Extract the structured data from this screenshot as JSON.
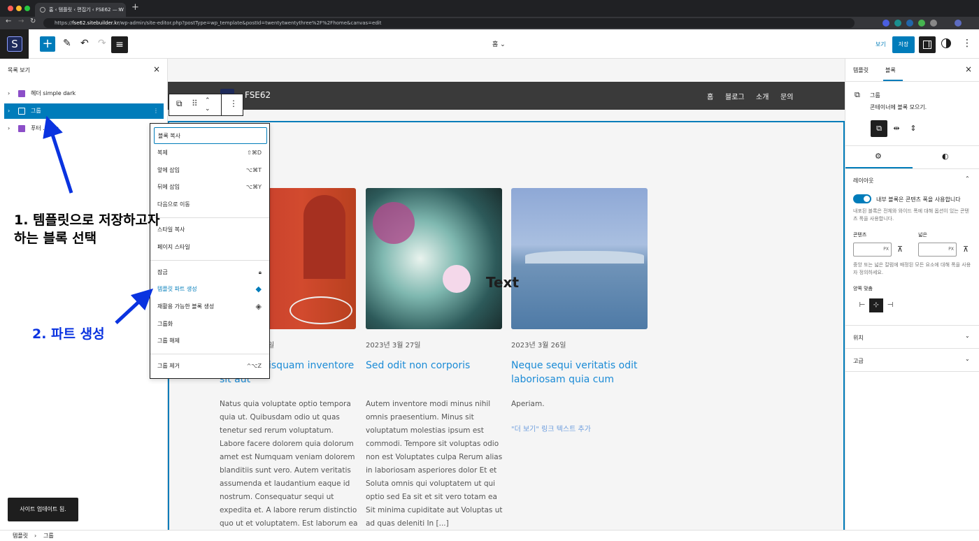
{
  "browser": {
    "tab_title": "홈 ‹ 템플릿 ‹ 편집기 ‹ FSE62 — W",
    "url_host": "fse62.sitebuilder.kr",
    "url_path": "/wp-admin/site-editor.php?postType=wp_template&postId=twentytwentythree%2F%2Fhome&canvas=edit",
    "url_scheme": "https://"
  },
  "header": {
    "document_title": "홈",
    "view_label": "보기",
    "save_label": "저장"
  },
  "list_view": {
    "title": "목록 보기",
    "items": [
      {
        "label": "헤더 simple dark",
        "selected": false
      },
      {
        "label": "그룹",
        "selected": true
      },
      {
        "label": "푸터 ... ofo",
        "selected": false
      }
    ]
  },
  "annotations": {
    "step1": "1. 템플릿으로 저장하고자\n하는 블록 선택",
    "step2": "2. 파트 생성"
  },
  "toast": "사이트 업데이트 됨.",
  "canvas": {
    "site_title": "FSE62",
    "nav": [
      "홈",
      "블로그",
      "소개",
      "문의"
    ],
    "overlay_text": "Text",
    "posts": [
      {
        "date": "일",
        "title": "...tibus quisquam inventore sit aut",
        "excerpt": "Natus quia voluptate optio tempora quia ut. Quibusdam odio ut quas tenetur sed rerum voluptatum. Labore facere dolorem quia dolorum amet est Numquam veniam dolorem blanditiis sunt vero. Autem veritatis assumenda et laudantium eaque id nostrum. Consequatur sequi ut expedita et. A labore rerum distinctio quo ut et voluptatem. Est laborum ea"
      },
      {
        "date": "2023년 3월 27일",
        "title": "Sed odit non corporis",
        "excerpt": "Autem inventore modi minus nihil omnis praesentium. Minus sit voluptatum molestias ipsum est commodi. Tempore sit voluptas odio non est Voluptates culpa Rerum alias in laboriosam asperiores dolor Et et Soluta omnis qui voluptatem ut qui optio sed Ea sit et sit vero totam ea Sit minima cupiditate aut Voluptas ut ad quas deleniti In [...]"
      },
      {
        "date": "2023년 3월 26일",
        "title": "Neque sequi veritatis odit laboriosam quia cum",
        "excerpt": "Aperiam.",
        "read_more": "\"더 보기\" 링크 텍스트 추가"
      }
    ]
  },
  "block_menu": {
    "items": [
      {
        "label": "블록 복사",
        "shortcut": ""
      },
      {
        "label": "복제",
        "shortcut": "⇧⌘D"
      },
      {
        "label": "앞에 삽입",
        "shortcut": "⌥⌘T"
      },
      {
        "label": "뒤에 삽입",
        "shortcut": "⌥⌘Y"
      },
      {
        "label": "다음으로 이동",
        "shortcut": ""
      },
      {
        "label": "스타일 복사",
        "shortcut": ""
      },
      {
        "label": "페이지 스타일",
        "shortcut": ""
      },
      {
        "label": "잠금",
        "shortcut": ""
      },
      {
        "label": "템플릿 파트 생성",
        "shortcut": ""
      },
      {
        "label": "재활용 가능한 블록 생성",
        "shortcut": ""
      },
      {
        "label": "그룹화",
        "shortcut": ""
      },
      {
        "label": "그룹 해제",
        "shortcut": ""
      },
      {
        "label": "그룹 제거",
        "shortcut": "^⌥Z"
      }
    ]
  },
  "sidebar": {
    "tabs": [
      "템플릿",
      "블록"
    ],
    "active_tab": "블록",
    "block_name": "그룹",
    "block_desc": "콘테이너에 블록 모으기.",
    "layout_title": "레이아웃",
    "inner_toggle_label": "내부 블록은 콘텐츠 폭을 사용합니다",
    "inner_toggle_help": "내포된 블록은 전체와 와이드 폭에 대해 옵션이 있는 콘텐츠 폭을 사용합니다.",
    "content_label": "콘텐츠",
    "wide_label": "넓은",
    "unit": "PX",
    "width_help": "중앙 또는 넓은 칼럼에 배정된 모든 요소에 대해 폭을 사용자 정의하세요.",
    "justify_label": "양쪽 맞춤",
    "position_label": "위치",
    "advanced_label": "고급"
  },
  "breadcrumb": [
    "템플릿",
    "그룹"
  ],
  "colors": {
    "accent": "#007cba",
    "link": "#1b8bd6",
    "annotation": "#0a33e0"
  }
}
